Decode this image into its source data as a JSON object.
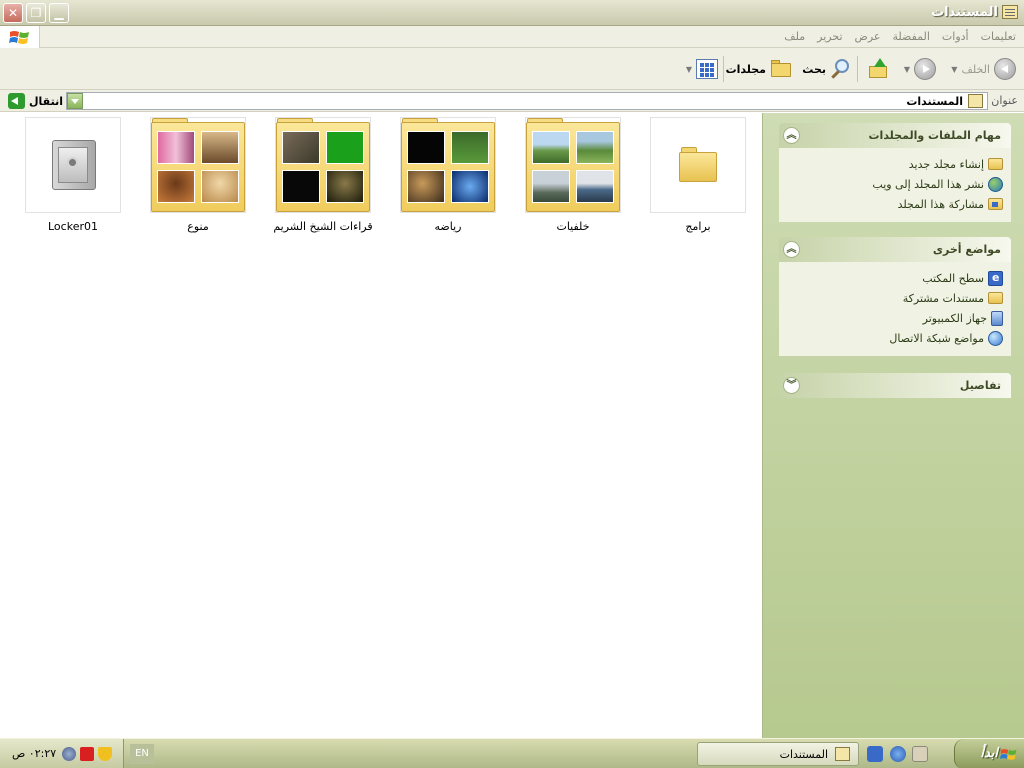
{
  "window": {
    "title": "المستندات"
  },
  "menu": {
    "items": [
      "ملف",
      "تحرير",
      "عرض",
      "المفضلة",
      "أدوات",
      "تعليمات"
    ]
  },
  "toolbar": {
    "back_label": "الخلف",
    "search_label": "بحث",
    "folders_label": "مجلدات"
  },
  "address": {
    "label": "عنوان",
    "value": "المستندات",
    "go_label": "انتقال"
  },
  "items": [
    {
      "label": "برامج",
      "type": "folder"
    },
    {
      "label": "خلفيات",
      "type": "folder-thumbs"
    },
    {
      "label": "رياضه",
      "type": "folder-thumbs"
    },
    {
      "label": "قراءات الشيخ الشريم",
      "type": "folder-thumbs"
    },
    {
      "label": "منوع",
      "type": "folder-thumbs"
    },
    {
      "label": "Locker01",
      "type": "safe"
    }
  ],
  "tasks": {
    "title": "مهام الملفات والمجلدات",
    "links": [
      "إنشاء مجلد جديد",
      "نشر هذا المجلد إلى ويب",
      "مشاركة هذا المجلد"
    ]
  },
  "other_places": {
    "title": "مواضع أخرى",
    "links": [
      "سطح المكتب",
      "مستندات مشتركة",
      "جهاز الكمبيوتر",
      "مواضع شبكة الاتصال"
    ]
  },
  "details": {
    "title": "تفاصيل"
  },
  "taskbar": {
    "start_label": "ابدأ",
    "task_label": "المستندات",
    "lang": "EN",
    "clock": "٠٢:٢٧ ص"
  },
  "icons": {
    "close": "close-icon",
    "maximize": "maximize-icon",
    "minimize": "minimize-icon",
    "back": "back-arrow-icon",
    "forward": "forward-arrow-icon",
    "up": "folder-up-icon",
    "search": "magnifier-icon",
    "folders": "folder-icon",
    "views": "views-grid-icon",
    "go": "go-arrow-icon",
    "windows": "windows-logo-icon"
  }
}
